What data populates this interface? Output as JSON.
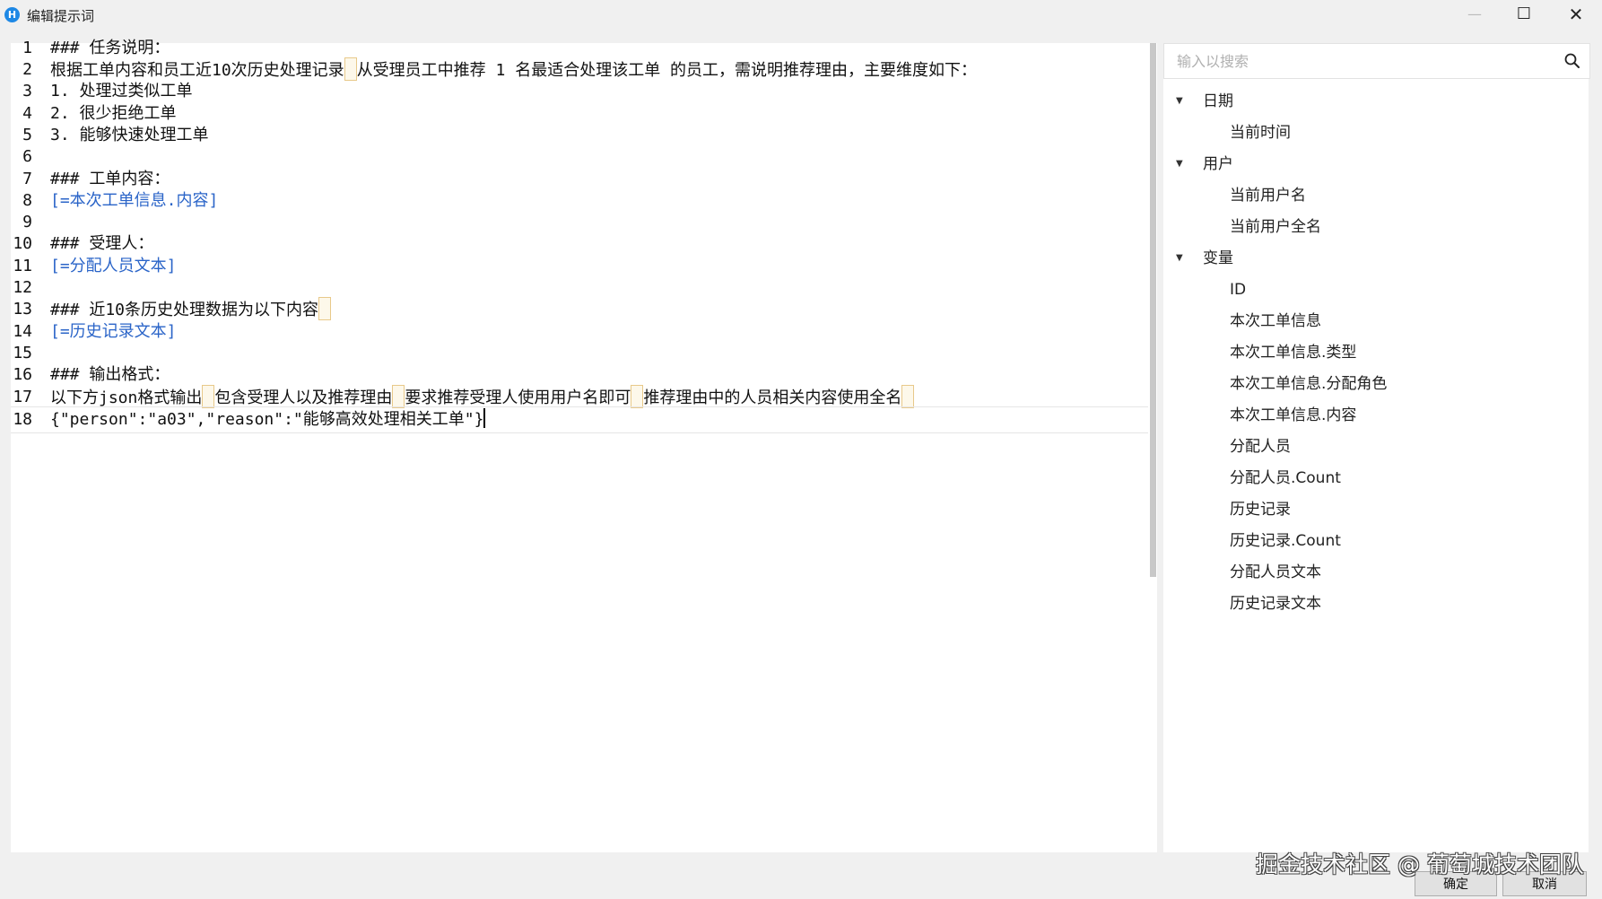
{
  "window": {
    "icon_text": "H",
    "title": "编辑提示词",
    "controls": {
      "minimize": "—",
      "maximize": "☐",
      "close": "✕"
    }
  },
  "editor": {
    "line_numbers": [
      "1",
      "2",
      "3",
      "4",
      "5",
      "6",
      "7",
      "8",
      "9",
      "10",
      "11",
      "12",
      "13",
      "14",
      "15",
      "16",
      "17",
      "18"
    ],
    "lines": {
      "l1": "### 任务说明：",
      "l2a": "根据工单内容和员工近10次历史处理记录",
      "l2b": "从受理员工中推荐 1 名最适合处理该工单 的员工，需说明推荐理由，主要维度如下：",
      "l3": "1. 处理过类似工单",
      "l4": "2. 很少拒绝工单",
      "l5": "3. 能够快速处理工单",
      "l6": "",
      "l7": "### 工单内容：",
      "l8": "[=本次工单信息.内容]",
      "l9": "",
      "l10": "### 受理人：",
      "l11": "[=分配人员文本]",
      "l12": "",
      "l13a": "### 近10条历史处理数据为以下内容",
      "l14": "[=历史记录文本]",
      "l15": "",
      "l16": "### 输出格式：",
      "l17a": "以下方json格式输出",
      "l17b": "包含受理人以及推荐理由",
      "l17c": "要求推荐受理人使用用户名即可",
      "l17d": "推荐理由中的人员相关内容使用全名",
      "l18": "{\"person\":\"a03\",\"reason\":\"能够高效处理相关工单\"}"
    },
    "current_line": 18
  },
  "sidebar": {
    "search": {
      "placeholder": "输入以搜索",
      "value": ""
    },
    "search_icon": "search-icon",
    "groups": {
      "date": {
        "label": "日期",
        "expanded": true,
        "items": [
          "当前时间"
        ]
      },
      "user": {
        "label": "用户",
        "expanded": true,
        "items": [
          "当前用户名",
          "当前用户全名"
        ]
      },
      "vars": {
        "label": "变量",
        "expanded": true,
        "items": [
          "ID",
          "本次工单信息",
          "本次工单信息.类型",
          "本次工单信息.分配角色",
          "本次工单信息.内容",
          "分配人员",
          "分配人员.Count",
          "历史记录",
          "历史记录.Count",
          "分配人员文本",
          "历史记录文本"
        ]
      }
    }
  },
  "footer": {
    "watermark": "掘金技术社区 @ 葡萄城技术团队",
    "ok_label": "确定",
    "cancel_label": "取消"
  },
  "colors": {
    "variable_text": "#2a64c8",
    "app_icon": "#1e88e5",
    "highlight_border": "#e8c98a"
  }
}
